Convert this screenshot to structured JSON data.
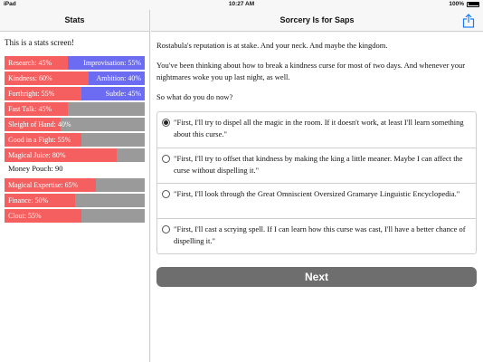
{
  "status_bar": {
    "carrier": "iPad",
    "time": "10:27 AM",
    "battery": "100%"
  },
  "sidebar": {
    "title": "Stats",
    "intro": "This is a stats screen!",
    "stats": [
      {
        "left": "Research: 45%",
        "right": "Improvisation: 55%",
        "value": 45,
        "opposed": true
      },
      {
        "left": "Kindness: 60%",
        "right": "Ambition: 40%",
        "value": 60,
        "opposed": true
      },
      {
        "left": "Forthright: 55%",
        "right": "Subtle: 45%",
        "value": 55,
        "opposed": true
      },
      {
        "left": "Fast Talk: 45%",
        "value": 45,
        "opposed": false
      },
      {
        "left": "Sleight of Hand: 40%",
        "value": 40,
        "opposed": false
      },
      {
        "left": "Good in a Fight: 55%",
        "value": 55,
        "opposed": false
      },
      {
        "left": "Magical Juice: 80%",
        "value": 80,
        "opposed": false
      }
    ],
    "money_pouch": "Money Pouch: 90",
    "stats2": [
      {
        "left": "Magical Expertise: 65%",
        "value": 65
      },
      {
        "left": "Finance: 50%",
        "value": 50
      },
      {
        "left": "Clout: 55%",
        "value": 55
      }
    ]
  },
  "main": {
    "title": "Sorcery Is for Saps",
    "share_icon": "share-icon",
    "paragraphs": [
      "Rostabula's reputation is at stake. And your neck. And maybe the kingdom.",
      "You've been thinking about how to break a kindness curse for most of two days. And whenever your nightmares woke you up last night, as well.",
      "So what do you do now?"
    ],
    "choices": [
      {
        "text": "\"First, I'll try to dispel all the magic in the room. If it doesn't work, at least I'll learn something about this curse.\"",
        "selected": true
      },
      {
        "text": "\"First, I'll try to offset that kindness by making the king a little meaner. Maybe I can affect the curse without dispelling it.\"",
        "selected": false
      },
      {
        "text": "\"First, I'll look through the Great Omniscient Oversized Gramarye Linguistic Encyclopedia.\"",
        "selected": false
      },
      {
        "text": "\"First, I'll cast a scrying spell. If I can learn how this curse was cast, I'll have a better chance of dispelling it.\"",
        "selected": false
      }
    ],
    "next_label": "Next"
  },
  "colors": {
    "fill": "#f55f5f",
    "opposed": "#6c6cf2",
    "empty": "#9a9a9a",
    "accent": "#1a7cf5",
    "button": "#6e6e6e"
  }
}
